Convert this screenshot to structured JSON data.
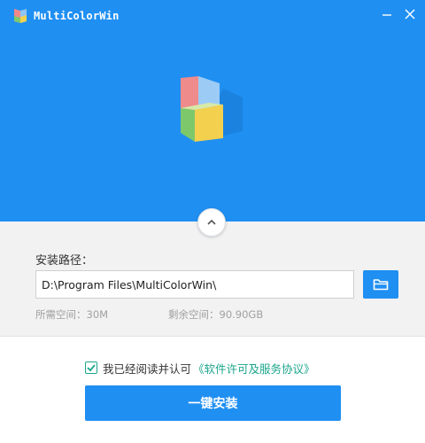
{
  "window": {
    "title": "MultiColorWin",
    "minimize_icon": "minimize-icon",
    "close_icon": "close-icon"
  },
  "header": {
    "background_color": "#1f8ff2",
    "logo_icon": "folder-logo-icon",
    "collapse_icon": "chevron-up-icon"
  },
  "install": {
    "path_label": "安装路径：",
    "path_value": "D:\\Program Files\\MultiColorWin\\",
    "browse_icon": "folder-icon",
    "required_space": "所需空间：30M",
    "free_space": "剩余空间：90.90GB"
  },
  "agreement": {
    "checked": true,
    "text": "我已经阅读并认可",
    "link_text": "《软件许可及服务协议》",
    "link_color": "#1aa58b"
  },
  "actions": {
    "install_label": "一键安装"
  }
}
